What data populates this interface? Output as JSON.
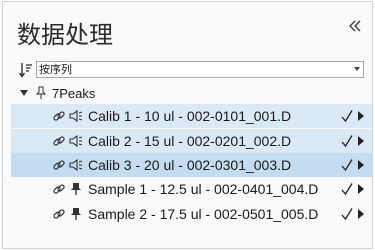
{
  "panel": {
    "title": "数据处理",
    "collapse_icon": "double-chevron-left-icon"
  },
  "sort": {
    "icon": "sort-descending-icon",
    "selected": "按序列"
  },
  "group": {
    "label": "7Peaks",
    "expanded": true,
    "pin_icon": "pin-outline-icon"
  },
  "rows": [
    {
      "label": "Calib 1 - 10 ul - 002-0101_001.D",
      "type": "calibration",
      "type_icon": "speaker-icon",
      "link_icon": "link-icon",
      "checked": true,
      "state": "highlighted"
    },
    {
      "label": "Calib 2 - 15 ul - 002-0201_002.D",
      "type": "calibration",
      "type_icon": "speaker-icon",
      "link_icon": "link-icon",
      "checked": true,
      "state": "highlighted"
    },
    {
      "label": "Calib 3 - 20 ul - 002-0301_003.D",
      "type": "calibration",
      "type_icon": "speaker-icon",
      "link_icon": "link-icon",
      "checked": true,
      "state": "selected"
    },
    {
      "label": "Sample 1 - 12.5 ul - 002-0401_004.D",
      "type": "sample",
      "type_icon": "pin-filled-icon",
      "link_icon": "link-icon",
      "checked": true,
      "state": "normal"
    },
    {
      "label": "Sample 2 - 17.5 ul - 002-0501_005.D",
      "type": "sample",
      "type_icon": "pin-filled-icon",
      "link_icon": "link-icon",
      "checked": true,
      "state": "normal"
    }
  ],
  "colors": {
    "row_highlight": "#dbe9f5",
    "row_selected": "#c3dcf0"
  }
}
